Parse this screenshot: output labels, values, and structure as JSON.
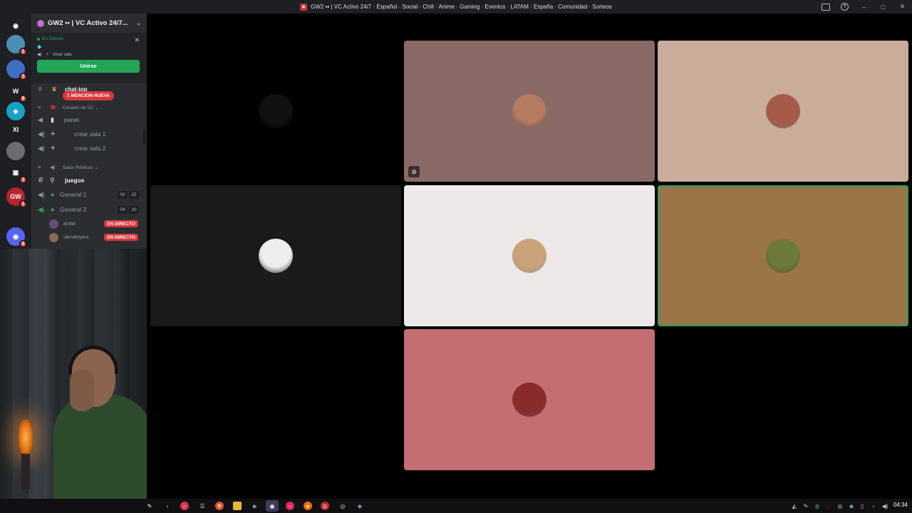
{
  "window": {
    "title": "GW2 ▪▪ | VC Activo 24/7 · Español · Social · Chill · Anime · Gaming · Eventos · LATAM · España · Comunidad · Sorteos",
    "help_glyph": "?",
    "minimize_glyph": "–",
    "maximize_glyph": "□",
    "close_glyph": "✕"
  },
  "server_rail": {
    "items": [
      {
        "name": "discord-home",
        "glyph": "◉",
        "color": "#1e1f22",
        "badge": ""
      },
      {
        "name": "server-1",
        "glyph": "",
        "color": "#4c8fb5",
        "badge": "1"
      },
      {
        "name": "server-2",
        "glyph": "",
        "color": "#3f6fc4",
        "badge": "3"
      },
      {
        "name": "server-3",
        "glyph": "W",
        "color": "#1e1f22",
        "badge": "9"
      },
      {
        "name": "server-4",
        "glyph": "◆",
        "color": "#1aa0c8",
        "badge": ""
      },
      {
        "name": "server-5",
        "glyph": "XI",
        "color": "#1e1f22",
        "badge": ""
      },
      {
        "name": "server-6",
        "glyph": "",
        "color": "#6b6b70",
        "badge": ""
      },
      {
        "name": "server-7",
        "glyph": "▣",
        "color": "#1e1f22",
        "badge": "3"
      },
      {
        "name": "server-8",
        "glyph": "GW",
        "color": "#b4262c",
        "badge": "1"
      },
      {
        "name": "server-9",
        "glyph": "◉",
        "color": "#5865f2",
        "badge": "6"
      }
    ]
  },
  "server": {
    "name": "GW2 ▪▪ | VC Activo 24/7...",
    "chevron": "⌄"
  },
  "live_banner": {
    "status": "En Directo",
    "close": "✕",
    "room": "crear sala",
    "join": "Unirse",
    "diamond": "◆"
  },
  "channels": {
    "chat_top": "chat-top",
    "mention": "1 MENCIÓN NUEVA",
    "category_vc": "Creador de VC ⌄",
    "panel": "panel",
    "crear_sala_1": "crear sala 1",
    "crear_sala_2": "crear sala 2",
    "category_public": "Salas Públicas ⌄",
    "juegos": "juegos",
    "general1": {
      "label": "General 1",
      "count_a": "00",
      "count_b": "15"
    },
    "general2": {
      "label": "General 2",
      "count_a": "04",
      "count_b": "10"
    },
    "users": [
      {
        "name": "arxtai",
        "live": "EN DIRECTO"
      },
      {
        "name": "slenderjavs",
        "live": "EN DIRECTO"
      }
    ]
  },
  "video_tiles": [
    {
      "name": "tile-1",
      "bg": "#000000",
      "avatar_color": "#111111",
      "muted": false,
      "speaking": false
    },
    {
      "name": "tile-2",
      "bg": "#8a6a66",
      "avatar_color": "#b57a62",
      "muted": true,
      "speaking": false
    },
    {
      "name": "tile-3",
      "bg": "#c9ac9a",
      "avatar_color": "#a65a4a",
      "muted": false,
      "speaking": false
    },
    {
      "name": "tile-4",
      "bg": "#1a1a1a",
      "avatar_color": "#eeeeee",
      "muted": false,
      "speaking": false
    },
    {
      "name": "tile-5",
      "bg": "#ebe8e7",
      "avatar_color": "#c9a27a",
      "muted": false,
      "speaking": false
    },
    {
      "name": "tile-6",
      "bg": "#9b7448",
      "avatar_color": "#6b7a3a",
      "muted": false,
      "speaking": true
    },
    {
      "name": "tile-7",
      "bg": "#c46e74",
      "avatar_color": "#8a2a2a",
      "muted": false,
      "speaking": false
    }
  ],
  "taskbar": {
    "clock": "04:34"
  },
  "colors": {
    "accent_green": "#23a55a",
    "live_red": "#da373c",
    "panel_bg": "#2b2d31",
    "rail_bg": "#1e1f22"
  }
}
